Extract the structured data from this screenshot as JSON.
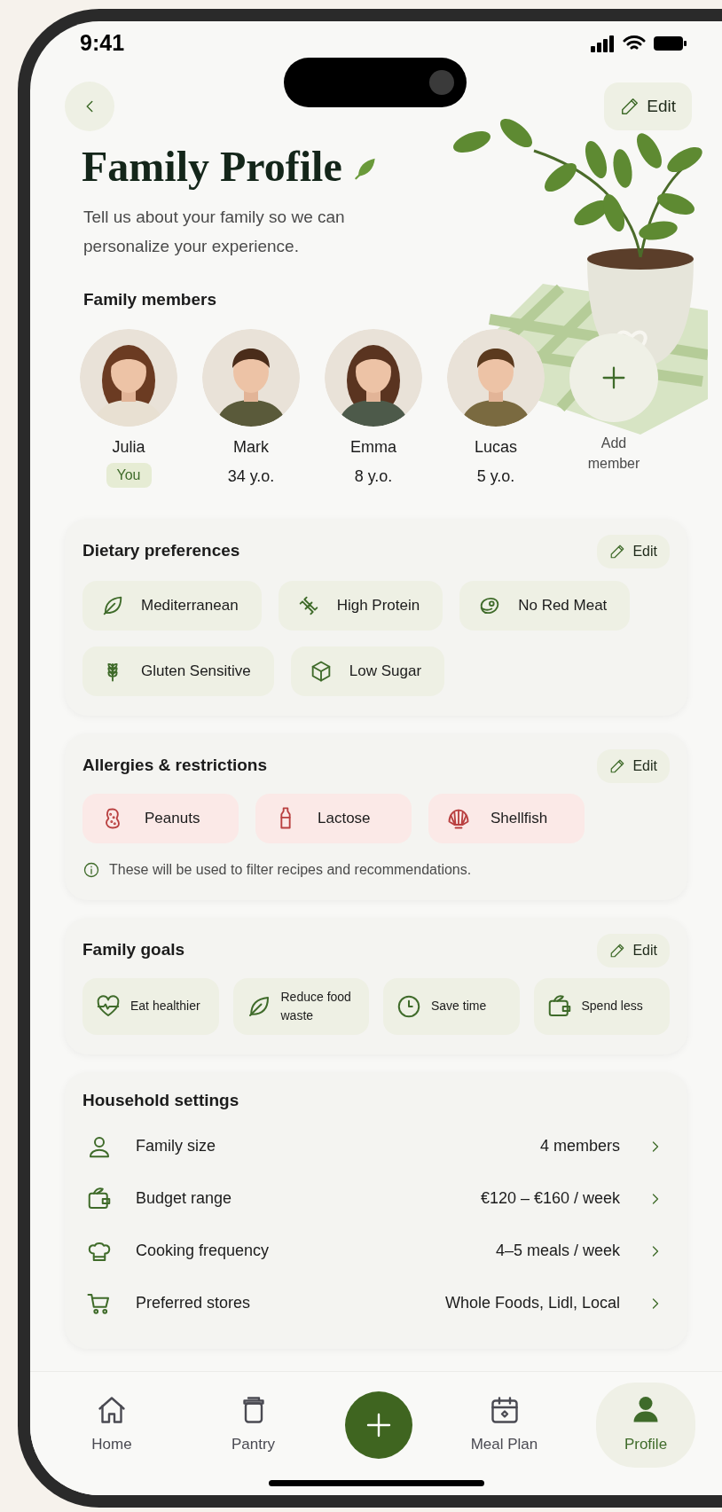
{
  "status_bar": {
    "time": "9:41"
  },
  "header": {
    "edit_label": "Edit",
    "title": "Family Profile",
    "subtitle": "Tell us about your family so we can personalize your experience."
  },
  "family_members": {
    "title": "Family members",
    "members": [
      {
        "name": "Julia",
        "badge": "You"
      },
      {
        "name": "Mark",
        "age": "34 y.o."
      },
      {
        "name": "Emma",
        "age": "8 y.o."
      },
      {
        "name": "Lucas",
        "age": "5 y.o."
      }
    ],
    "add_label": "Add member"
  },
  "dietary_preferences": {
    "title": "Dietary preferences",
    "edit_label": "Edit",
    "tags": [
      "Mediterranean",
      "High Protein",
      "No Red Meat",
      "Gluten Sensitive",
      "Low Sugar"
    ]
  },
  "allergies": {
    "title": "Allergies & restrictions",
    "edit_label": "Edit",
    "tags": [
      "Peanuts",
      "Lactose",
      "Shellfish"
    ],
    "note": "These will be used to filter recipes and recommendations."
  },
  "family_goals": {
    "title": "Family goals",
    "edit_label": "Edit",
    "goals": [
      "Eat healthier",
      "Reduce food waste",
      "Save time",
      "Spend less"
    ]
  },
  "household_settings": {
    "title": "Household settings",
    "rows": [
      {
        "label": "Family size",
        "value": "4 members"
      },
      {
        "label": "Budget range",
        "value": "€120 – €160 / week"
      },
      {
        "label": "Cooking frequency",
        "value": "4–5 meals / week"
      },
      {
        "label": "Preferred stores",
        "value": "Whole Foods, Lidl, Local"
      }
    ]
  },
  "bottom_nav": {
    "items": [
      {
        "kind": "tab",
        "label": "Home",
        "selected": false
      },
      {
        "kind": "tab",
        "label": "Pantry",
        "selected": false
      },
      {
        "kind": "action",
        "selected": false
      },
      {
        "kind": "tab",
        "label": "Meal Plan",
        "selected": false
      },
      {
        "kind": "tab",
        "label": "Profile",
        "selected": true
      }
    ]
  }
}
